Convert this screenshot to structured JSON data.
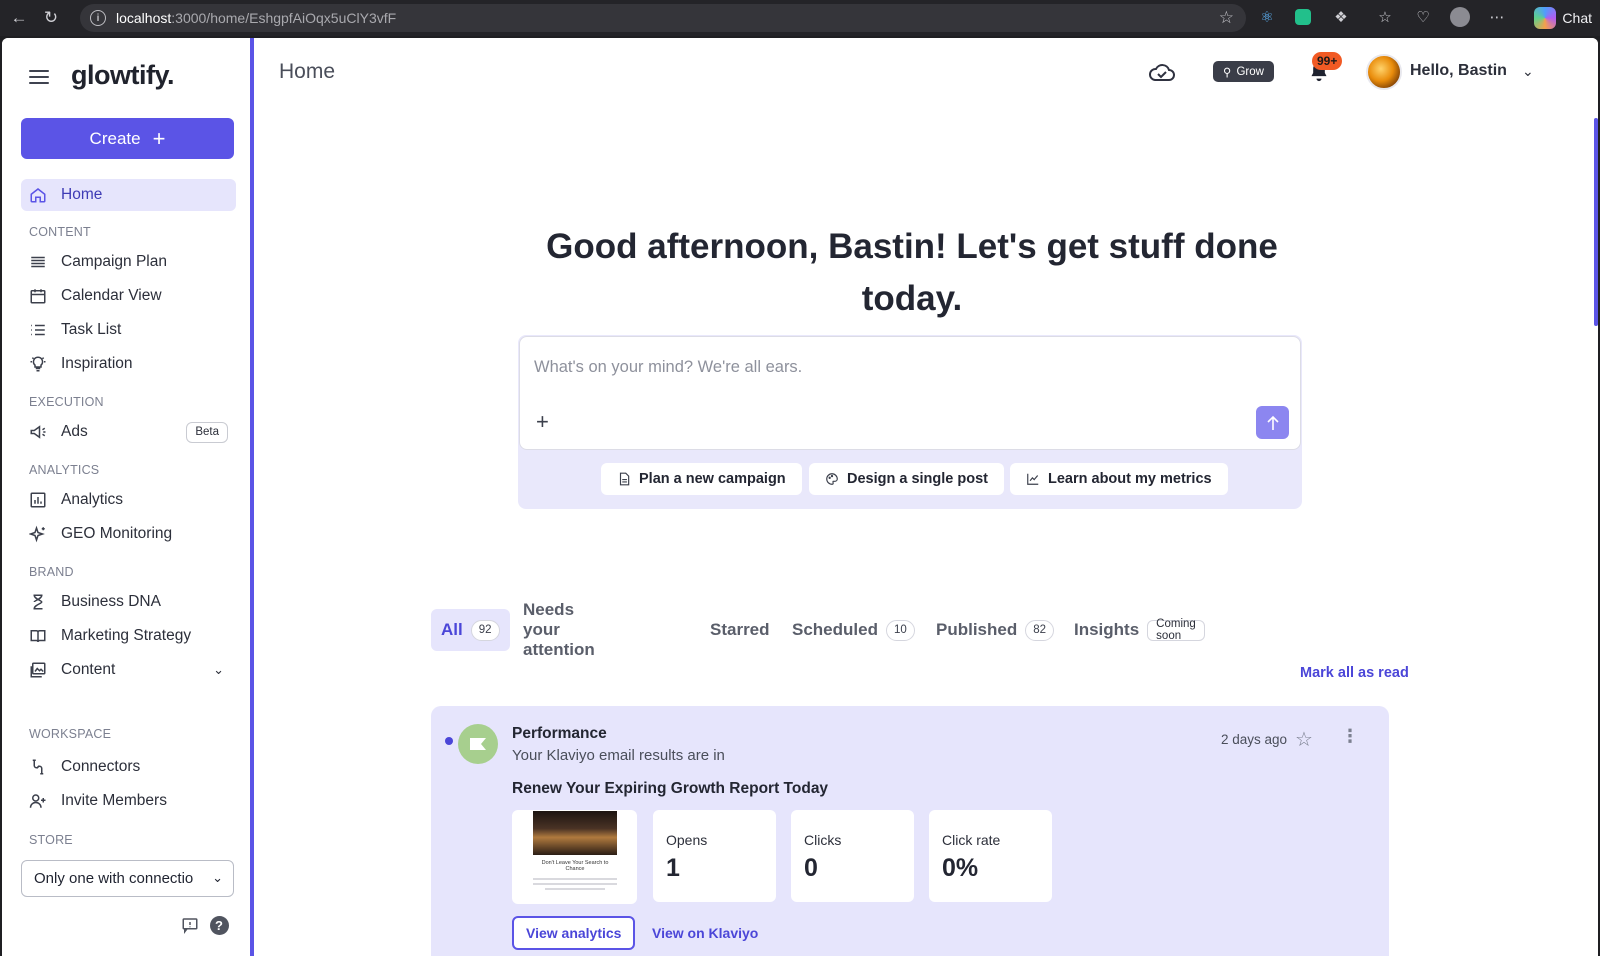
{
  "browser": {
    "url_host": "localhost",
    "url_path": ":3000/home/EshgpfAiOqx5uClY3vfF",
    "chat_label": "Chat"
  },
  "sidebar": {
    "logo": "glowtify.",
    "create_label": "Create",
    "home_label": "Home",
    "sections": {
      "content": "CONTENT",
      "execution": "EXECUTION",
      "analytics": "ANALYTICS",
      "brand": "BRAND",
      "workspace": "WORKSPACE",
      "store": "STORE"
    },
    "items": {
      "campaign_plan": "Campaign Plan",
      "calendar_view": "Calendar View",
      "task_list": "Task List",
      "inspiration": "Inspiration",
      "ads": "Ads",
      "ads_badge": "Beta",
      "analytics": "Analytics",
      "geo_monitoring": "GEO Monitoring",
      "business_dna": "Business DNA",
      "marketing_strategy": "Marketing Strategy",
      "content": "Content",
      "connectors": "Connectors",
      "invite_members": "Invite Members"
    },
    "store_select_value": "Only one with connectio"
  },
  "header": {
    "title": "Home",
    "grow_label": "Grow",
    "notification_count": "99+",
    "greeting": "Hello, Bastin"
  },
  "hero": {
    "headline": "Good afternoon, Bastin! Let's get stuff done today.",
    "composer_placeholder": "What's on your mind? We're all ears.",
    "chips": [
      "Plan a new campaign",
      "Design a single post",
      "Learn about my metrics"
    ]
  },
  "tabs": {
    "all": "All",
    "all_count": "92",
    "attention": "Needs your attention",
    "starred": "Starred",
    "scheduled": "Scheduled",
    "scheduled_count": "10",
    "published": "Published",
    "published_count": "82",
    "insights": "Insights",
    "insights_badge": "Coming soon",
    "mark_all_read": "Mark all as read"
  },
  "feed": {
    "category": "Performance",
    "subtitle": "Your Klaviyo email results are in",
    "time": "2 days ago",
    "subject": "Renew Your Expiring Growth Report Today",
    "thumb_text": "Don't Leave Your Search to Chance",
    "metrics": [
      {
        "label": "Opens",
        "value": "1"
      },
      {
        "label": "Clicks",
        "value": "0"
      },
      {
        "label": "Click rate",
        "value": "0%"
      }
    ],
    "view_analytics": "View analytics",
    "view_klaviyo": "View on Klaviyo"
  },
  "colors": {
    "accent": "#5b54e6",
    "accent_light": "#e6e5fc",
    "badge": "#f15a24"
  }
}
